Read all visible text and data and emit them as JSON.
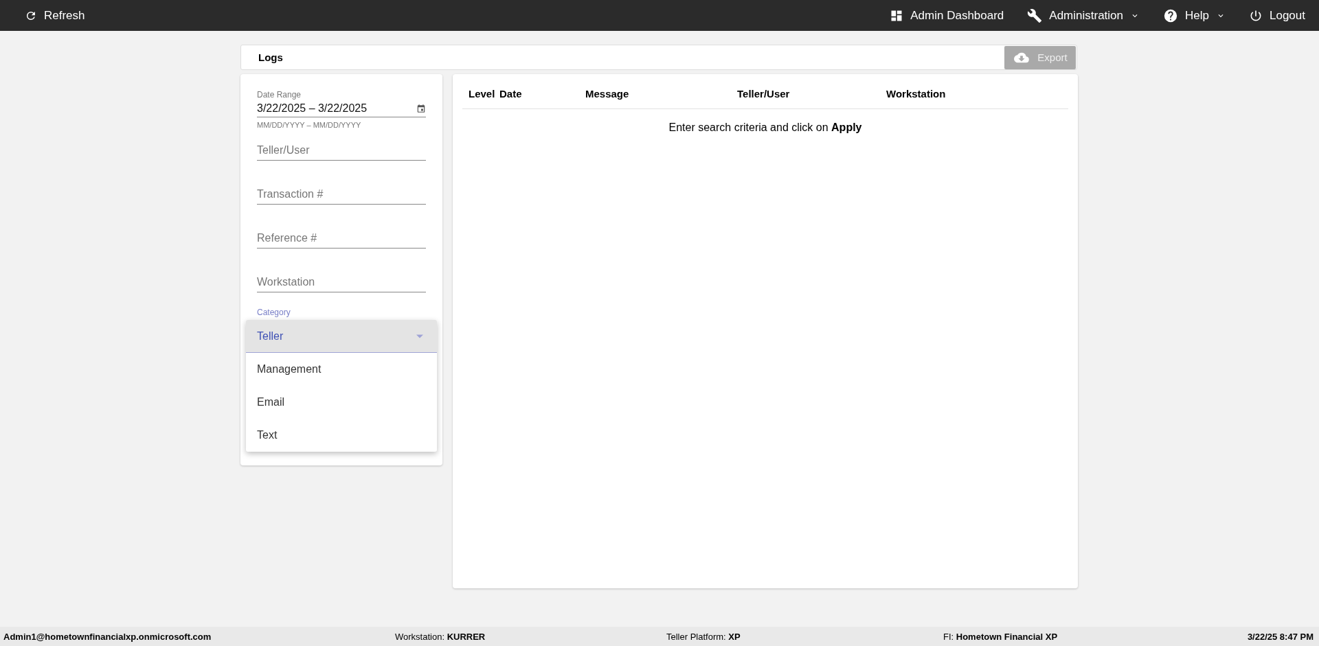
{
  "topbar": {
    "left": {
      "label": "Refresh",
      "kind": "refresh"
    },
    "right": [
      {
        "label": "Admin Dashboard",
        "kind": "dashboard",
        "caret": false
      },
      {
        "label": "Administration",
        "kind": "wrench",
        "caret": true
      },
      {
        "label": "Help",
        "kind": "help",
        "caret": true
      },
      {
        "label": "Logout",
        "kind": "power",
        "caret": false
      }
    ]
  },
  "page": {
    "title": "Logs",
    "export": {
      "label": "Export",
      "disabled": true
    }
  },
  "filters": {
    "date_range": {
      "label": "Date Range",
      "value": "3/22/2025 – 3/22/2025",
      "hint": "MM/DD/YYYY – MM/DD/YYYY"
    },
    "fields": [
      {
        "placeholder": "Teller/User"
      },
      {
        "placeholder": "Transaction #"
      },
      {
        "placeholder": "Reference #"
      },
      {
        "placeholder": "Workstation"
      }
    ],
    "category": {
      "label": "Category",
      "focused": true
    }
  },
  "category_menu": [
    {
      "label": "Teller",
      "selected": true
    },
    {
      "label": "Management",
      "selected": false
    },
    {
      "label": "Email",
      "selected": false
    },
    {
      "label": "Text",
      "selected": false
    }
  ],
  "table": {
    "columns": [
      "Level",
      "Date",
      "Message",
      "Teller/User",
      "Workstation"
    ],
    "empty_message": "Enter search criteria and click on **Apply**"
  },
  "status_bar": {
    "user": "Admin1@hometownfinancialxp.onmicrosoft.com",
    "workstation": "Workstation: **KURRER**",
    "platform": "Teller Platform: **XP**",
    "fi": "FI: **Hometown Financial XP**",
    "datetime": "3/22/25 8:47 PM"
  }
}
